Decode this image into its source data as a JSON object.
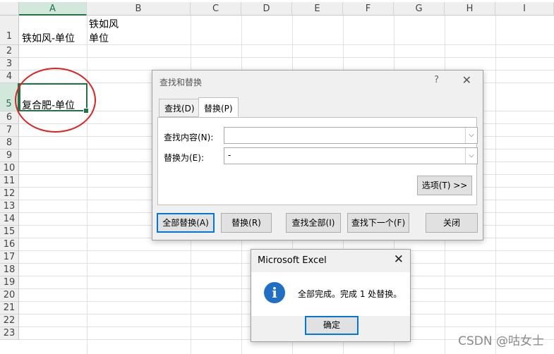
{
  "sheet": {
    "columns": [
      "A",
      "B",
      "C",
      "D",
      "E",
      "F",
      "G",
      "H",
      "I"
    ],
    "rows": [
      "1",
      "2",
      "3",
      "4",
      "5",
      "6",
      "7",
      "8",
      "9",
      "10",
      "11",
      "12",
      "13",
      "14",
      "15",
      "16",
      "17",
      "18",
      "19",
      "20",
      "21",
      "22",
      "23"
    ],
    "cells": {
      "A1": "铁如风-单位",
      "B1_line1": "铁如风",
      "B1_line2": "单位",
      "A5": "复合肥-单位"
    }
  },
  "find_replace": {
    "title": "查找和替换",
    "help": "?",
    "close": "✕",
    "tabs": [
      "查找(D)",
      "替换(P)"
    ],
    "find_label": "查找内容(N):",
    "find_value": "",
    "replace_label": "替换为(E):",
    "replace_value": "-",
    "options_button": "选项(T) >>",
    "buttons": {
      "replace_all": "全部替换(A)",
      "replace": "替换(R)",
      "find_all": "查找全部(I)",
      "find_next": "查找下一个(F)",
      "close": "关闭"
    }
  },
  "message_box": {
    "title": "Microsoft Excel",
    "close": "✕",
    "icon": "i",
    "text": "全部完成。完成 1 处替换。",
    "ok": "确定"
  },
  "watermark": "CSDN @咕女士",
  "colors": {
    "accent": "#217346",
    "focus": "#0078d7",
    "annotation": "#e02020",
    "info_icon": "#1f6fc5"
  }
}
